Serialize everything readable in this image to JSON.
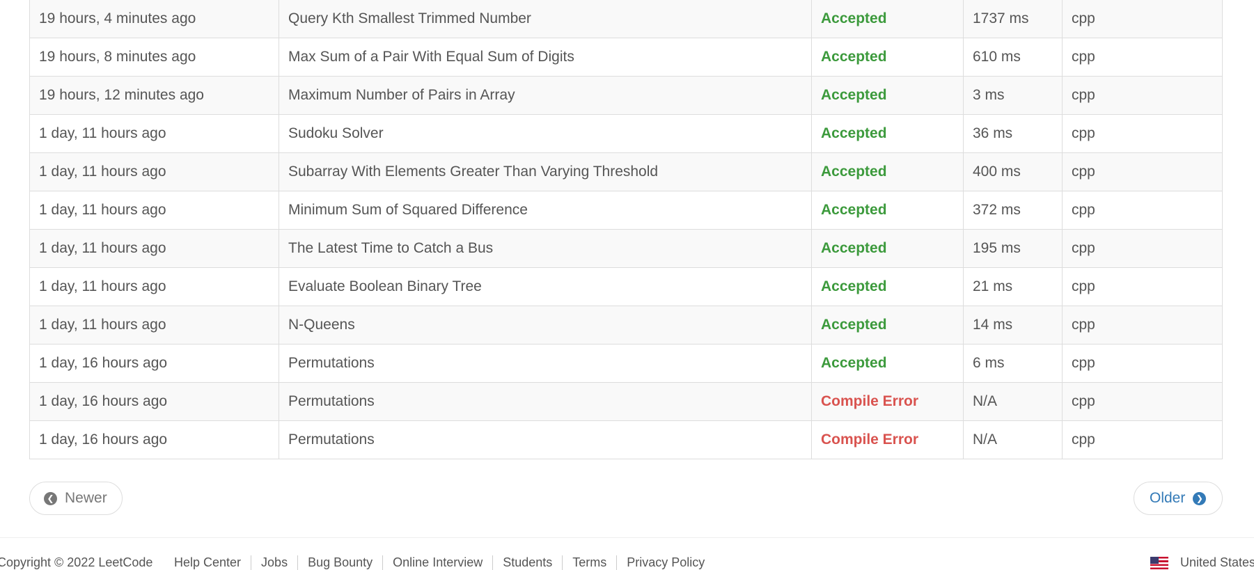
{
  "submissions": [
    {
      "time": "19 hours, 4 minutes ago",
      "question": "Query Kth Smallest Trimmed Number",
      "status": "Accepted",
      "runtime": "1737 ms",
      "lang": "cpp"
    },
    {
      "time": "19 hours, 8 minutes ago",
      "question": "Max Sum of a Pair With Equal Sum of Digits",
      "status": "Accepted",
      "runtime": "610 ms",
      "lang": "cpp"
    },
    {
      "time": "19 hours, 12 minutes ago",
      "question": "Maximum Number of Pairs in Array",
      "status": "Accepted",
      "runtime": "3 ms",
      "lang": "cpp"
    },
    {
      "time": "1 day, 11 hours ago",
      "question": "Sudoku Solver",
      "status": "Accepted",
      "runtime": "36 ms",
      "lang": "cpp"
    },
    {
      "time": "1 day, 11 hours ago",
      "question": "Subarray With Elements Greater Than Varying Threshold",
      "status": "Accepted",
      "runtime": "400 ms",
      "lang": "cpp"
    },
    {
      "time": "1 day, 11 hours ago",
      "question": "Minimum Sum of Squared Difference",
      "status": "Accepted",
      "runtime": "372 ms",
      "lang": "cpp"
    },
    {
      "time": "1 day, 11 hours ago",
      "question": "The Latest Time to Catch a Bus",
      "status": "Accepted",
      "runtime": "195 ms",
      "lang": "cpp"
    },
    {
      "time": "1 day, 11 hours ago",
      "question": "Evaluate Boolean Binary Tree",
      "status": "Accepted",
      "runtime": "21 ms",
      "lang": "cpp"
    },
    {
      "time": "1 day, 11 hours ago",
      "question": "N-Queens",
      "status": "Accepted",
      "runtime": "14 ms",
      "lang": "cpp"
    },
    {
      "time": "1 day, 16 hours ago",
      "question": "Permutations",
      "status": "Accepted",
      "runtime": "6 ms",
      "lang": "cpp"
    },
    {
      "time": "1 day, 16 hours ago",
      "question": "Permutations",
      "status": "Compile Error",
      "runtime": "N/A",
      "lang": "cpp"
    },
    {
      "time": "1 day, 16 hours ago",
      "question": "Permutations",
      "status": "Compile Error",
      "runtime": "N/A",
      "lang": "cpp"
    }
  ],
  "pager": {
    "newer_label": "Newer",
    "newer_icon": "chevron-left-circle-icon",
    "older_label": "Older",
    "older_icon": "chevron-right-circle-icon"
  },
  "footer": {
    "copyright": "Copyright © 2022 LeetCode",
    "links": [
      "Help Center",
      "Jobs",
      "Bug Bounty",
      "Online Interview",
      "Students",
      "Terms",
      "Privacy Policy"
    ],
    "region": "United States",
    "region_icon": "us-flag-icon"
  },
  "colors": {
    "accepted": "#3c9a3c",
    "error": "#d9534f",
    "link": "#337ab7"
  }
}
